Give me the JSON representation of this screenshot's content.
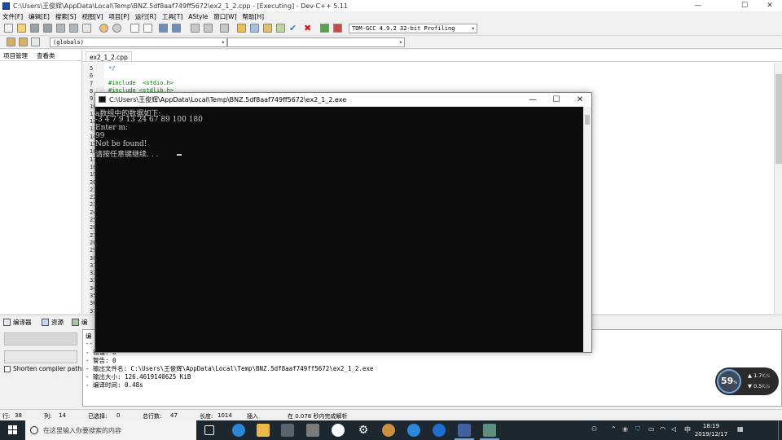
{
  "window": {
    "title": "C:\\Users\\王俊辉\\AppData\\Local\\Temp\\BNZ.5df8aaf749ff5672\\ex2_1_2.cpp - [Executing] - Dev-C++ 5.11",
    "minimize": "—",
    "maximize": "☐",
    "close": "✕"
  },
  "menu": [
    "文件[F]",
    "编辑[E]",
    "搜索[S]",
    "视图[V]",
    "项目[P]",
    "运行[R]",
    "工具[T]",
    "AStyle",
    "窗口[W]",
    "帮助[H]"
  ],
  "toolbar": {
    "compiler_select": "TDM-GCC 4.9.2 32-bit Profiling",
    "scope_select": "(globals)"
  },
  "left_panel": {
    "tabs": [
      "项目管理",
      "查看类"
    ]
  },
  "editor": {
    "tab": "ex2_1_2.cpp",
    "line_numbers": [
      "5",
      "6",
      "7",
      "8",
      "9",
      "10",
      "11",
      "12",
      "13",
      "14",
      "15",
      "16",
      "17",
      "18",
      "19",
      "20",
      "21",
      "22",
      "23",
      "24",
      "25",
      "26",
      "27",
      "28",
      "29",
      "30",
      "31",
      "32",
      "33",
      "34",
      "35",
      "36",
      "37"
    ],
    "code_lines": [
      "*/",
      "",
      "#include  <stdio.h>",
      "#include <stdlib.h>"
    ]
  },
  "console": {
    "title": "C:\\Users\\王俊辉\\AppData\\Local\\Temp\\BNZ.5df8aaf749ff5672\\ex2_1_2.exe",
    "lines": [
      "a数组中的数据如下:",
      "-3 4 7 9 13 24 67 89 100 180",
      "Enter m:",
      "99",
      "Not be found!",
      "请按任意键继续. . ."
    ]
  },
  "bottom": {
    "tabs": [
      "编译器",
      "资源",
      "编"
    ],
    "shorten_label": "Shorten compiler paths",
    "log_lines": [
      "编",
      "--",
      "- 错误: 0",
      "- 警告: 0",
      "- 输出文件名: C:\\Users\\王俊辉\\AppData\\Local\\Temp\\BNZ.5df8aaf749ff5672\\ex2_1_2.exe",
      "- 输出大小: 126.4619140625 KiB",
      "- 编译时间: 0.48s"
    ]
  },
  "status": {
    "row_label": "行:",
    "row_value": "38",
    "col_label": "列:",
    "col_value": "14",
    "sel_label": "已选择:",
    "sel_value": "0",
    "total_label": "总行数:",
    "total_value": "47",
    "len_label": "长度:",
    "len_value": "1014",
    "mode": "插入",
    "parse": "在 0.078 秒内完成解析"
  },
  "net_widget": {
    "percent": "59",
    "percent_unit": "%",
    "up": "1.7",
    "up_unit": "K/s",
    "down": "0.5",
    "down_unit": "K/s"
  },
  "taskbar": {
    "search_placeholder": "在这里输入你要搜索的内容",
    "ime": "中",
    "time": "18:19",
    "date": "2019/12/17"
  },
  "colors": {
    "console_bg": "#0c0c0c",
    "console_text": "#cccccc",
    "taskbar_bg": "#1c2730",
    "code_green": "#008000",
    "code_blue": "#1e5aa8"
  }
}
